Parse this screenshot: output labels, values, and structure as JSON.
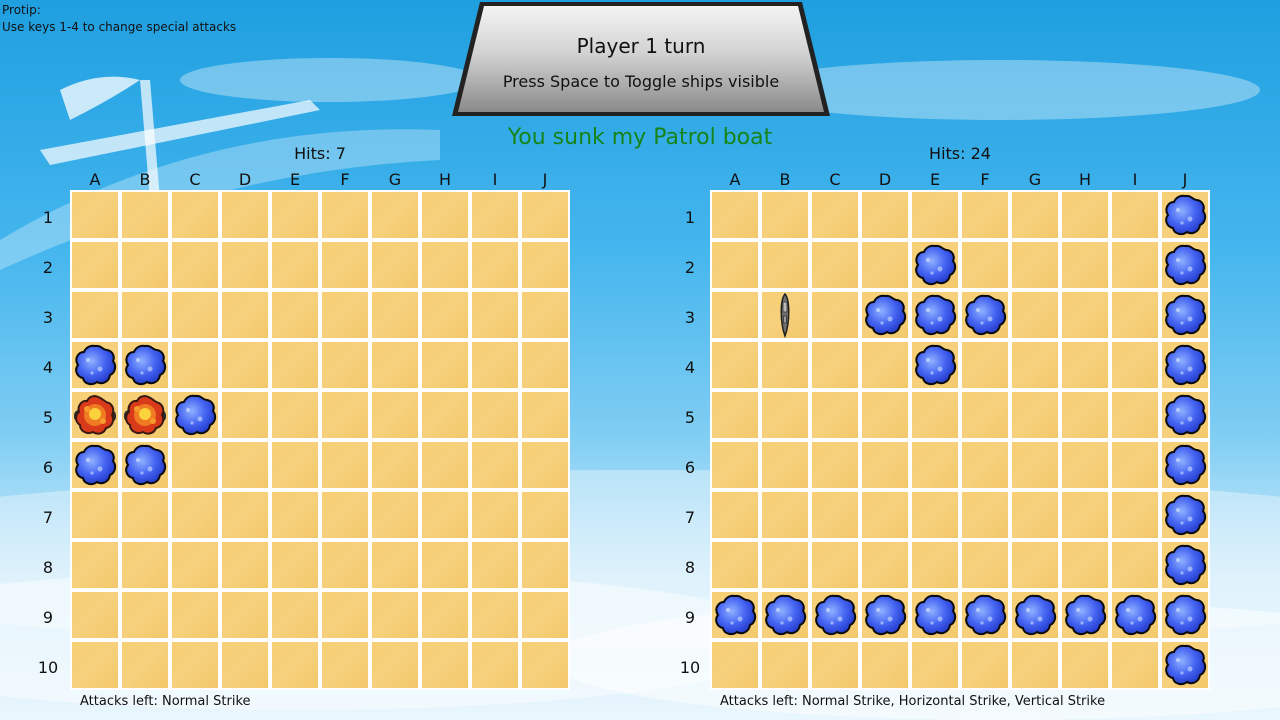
{
  "protip": {
    "title": "Protip:",
    "text": "Use keys 1-4 to change special attacks"
  },
  "banner": {
    "title": "Player 1 turn",
    "subtitle": "Press Space to Toggle ships visible"
  },
  "message": "You sunk my Patrol boat",
  "colors": {
    "cell": "#f6cf78",
    "message": "#17841a",
    "splash": "#3d5ef0",
    "explosion": "#e2401c"
  },
  "columns": [
    "A",
    "B",
    "C",
    "D",
    "E",
    "F",
    "G",
    "H",
    "I",
    "J"
  ],
  "rows": [
    "1",
    "2",
    "3",
    "4",
    "5",
    "6",
    "7",
    "8",
    "9",
    "10"
  ],
  "boards": [
    {
      "hits_label": "Hits: 7",
      "attacks_label": "Attacks left:  Normal Strike",
      "misses": [
        [
          3,
          0
        ],
        [
          3,
          1
        ],
        [
          4,
          2
        ],
        [
          5,
          0
        ],
        [
          5,
          1
        ]
      ],
      "explosions": [
        [
          4,
          0
        ],
        [
          4,
          1
        ]
      ],
      "ships": []
    },
    {
      "hits_label": "Hits: 24",
      "attacks_label": "Attacks left:  Normal Strike, Horizontal Strike, Vertical Strike",
      "misses": [
        [
          0,
          9
        ],
        [
          1,
          4
        ],
        [
          1,
          9
        ],
        [
          2,
          3
        ],
        [
          2,
          4
        ],
        [
          2,
          5
        ],
        [
          2,
          9
        ],
        [
          3,
          4
        ],
        [
          3,
          9
        ],
        [
          4,
          9
        ],
        [
          5,
          9
        ],
        [
          6,
          9
        ],
        [
          7,
          9
        ],
        [
          8,
          0
        ],
        [
          8,
          1
        ],
        [
          8,
          2
        ],
        [
          8,
          3
        ],
        [
          8,
          4
        ],
        [
          8,
          5
        ],
        [
          8,
          6
        ],
        [
          8,
          7
        ],
        [
          8,
          8
        ],
        [
          8,
          9
        ],
        [
          9,
          9
        ]
      ],
      "explosions": [],
      "ships": [
        [
          2,
          1
        ]
      ]
    }
  ]
}
